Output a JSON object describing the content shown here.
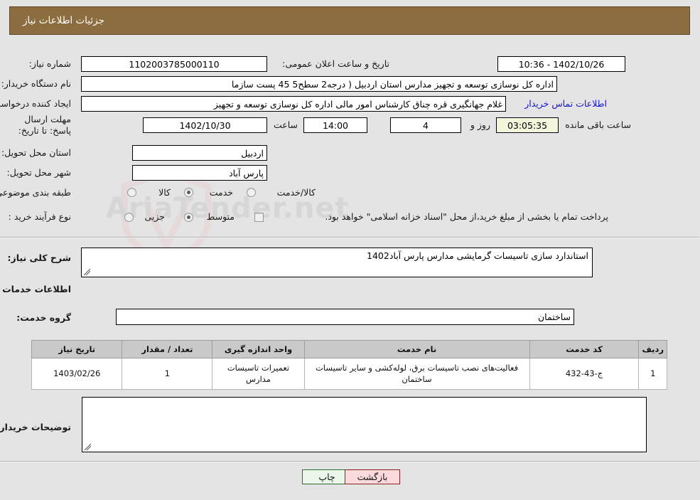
{
  "header": {
    "title": "جزئیات اطلاعات نیاز"
  },
  "watermark": {
    "text": "AriaTender.net"
  },
  "form": {
    "need_number_label": "شماره نیاز:",
    "need_number_value": "1102003785000110",
    "public_announce_label": "تاریخ و ساعت اعلان عمومی:",
    "public_announce_value": "1402/10/26 - 10:36",
    "buyer_org_label": "نام دستگاه خریدار:",
    "buyer_org_value": "اداره کل نوسازی   توسعه و تجهیز مدارس استان اردبیل ( درجه2  سطح5  45 پست سازما",
    "creator_label": "ایجاد کننده درخواست:",
    "creator_value": "غلام جهانگیری قره چناق کارشناس امور مالی اداره کل نوسازی   توسعه و تجهیز",
    "contact_link": "اطلاعات تماس خریدار",
    "deadline_label": "مهلت ارسال پاسخ: تا تاریخ:",
    "deadline_date": "1402/10/30",
    "deadline_hour_label": "ساعت",
    "deadline_hour_value": "14:00",
    "remaining_days_value": "4",
    "remaining_days_label": "روز و",
    "remaining_time_value": "03:05:35",
    "remaining_time_label": "ساعت باقی مانده",
    "province_label": "استان محل تحویل:",
    "province_value": "اردبیل",
    "city_label": "شهر محل تحویل:",
    "city_value": "پارس آباد",
    "category_label": "طبقه بندی موضوعی:",
    "category_options": [
      {
        "label": "کالا",
        "selected": false
      },
      {
        "label": "خدمت",
        "selected": true
      },
      {
        "label": "کالا/خدمت",
        "selected": false
      }
    ],
    "process_label": "نوع فرآیند خرید :",
    "process_options": [
      {
        "label": "جزیی",
        "selected": false
      },
      {
        "label": "متوسط",
        "selected": true
      }
    ],
    "treasury_checkbox_label": "پرداخت تمام یا بخشی از مبلغ خرید،از محل \"اسناد خزانه اسلامی\" خواهد بود.",
    "treasury_checked": false
  },
  "description": {
    "general_label": "شرح کلی نیاز:",
    "general_value": "استاندارد سازی تاسیسات گرمایشی مدارس پارس آباد1402",
    "services_heading": "اطلاعات خدمات مورد نیاز",
    "service_group_label": "گروه خدمت:",
    "service_group_value": "ساختمان"
  },
  "table": {
    "columns": [
      "ردیف",
      "کد خدمت",
      "نام خدمت",
      "واحد اندازه گیری",
      "تعداد / مقدار",
      "تاریخ نیاز"
    ],
    "rows": [
      {
        "row": "1",
        "code": "ج-43-432",
        "name": "فعالیت‌های نصب تاسیسات برق، لوله‌کشی و سایر تاسیسات ساختمان",
        "unit": "تعمیرات تاسیسات مدارس",
        "qty": "1",
        "date": "1403/02/26"
      }
    ]
  },
  "buyer_notes": {
    "label": "توضیحات خریدار:",
    "value": ""
  },
  "buttons": {
    "print": "چاپ",
    "back": "بازگشت"
  }
}
